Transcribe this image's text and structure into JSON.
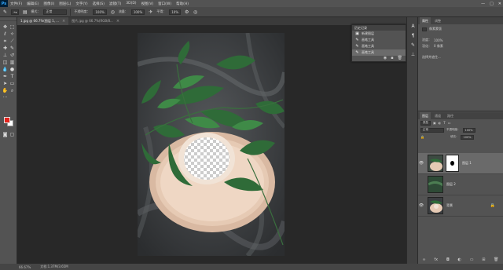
{
  "menubar": {
    "logo": "Ps",
    "items": [
      "文件(F)",
      "编辑(E)",
      "图像(I)",
      "图层(L)",
      "文字(Y)",
      "选择(S)",
      "滤镜(T)",
      "3D(D)",
      "视图(V)",
      "窗口(W)",
      "帮助(H)"
    ],
    "win_min": "—",
    "win_max": "□",
    "win_close": "✕"
  },
  "options": {
    "mode_label": "模式：",
    "mode_value": "正常",
    "opacity_label": "不透明度：",
    "opacity_value": "100%",
    "flow_label": "流量：",
    "flow_value": "100%",
    "smooth_label": "平滑：",
    "smooth_value": "10%"
  },
  "tabs": [
    {
      "label": "1.jpg @ 66.7%(图层 1, ...",
      "active": true
    },
    {
      "label": "图片.jpg @ 66.7%(RGB/8...",
      "active": false
    }
  ],
  "history": {
    "title": "历史记录",
    "items": [
      {
        "label": "新建图层",
        "selected": false
      },
      {
        "label": "画笔工具",
        "selected": false
      },
      {
        "label": "画笔工具",
        "selected": false
      },
      {
        "label": "画笔工具",
        "selected": true
      }
    ]
  },
  "properties": {
    "tabs": [
      "属性",
      "调整"
    ],
    "title": "像素蒙版",
    "density_label": "浓度：",
    "density_value": "100%",
    "feather_label": "羽化：",
    "feather_value": "0 像素",
    "refine_label": "选择并遮住..."
  },
  "layers": {
    "tabs": [
      "图层",
      "通道",
      "路径"
    ],
    "kind_label": "类型",
    "blend_mode": "正常",
    "opacity_label": "不透明度：",
    "opacity_value": "100%",
    "fill_label": "填充：",
    "fill_value": "100%",
    "items": [
      {
        "name": "图层 1",
        "selected": true,
        "has_mask": true
      },
      {
        "name": "图层 2",
        "selected": false,
        "has_mask": false
      },
      {
        "name": "背景",
        "selected": false,
        "has_mask": false,
        "locked": true
      }
    ]
  },
  "status": {
    "zoom": "66.67%",
    "doc_info": "文档:1.37M/3.65M"
  },
  "colors": {
    "foreground": "#e3231c",
    "background": "#ffffff",
    "ui_dark": "#282828",
    "panel": "#535353"
  }
}
